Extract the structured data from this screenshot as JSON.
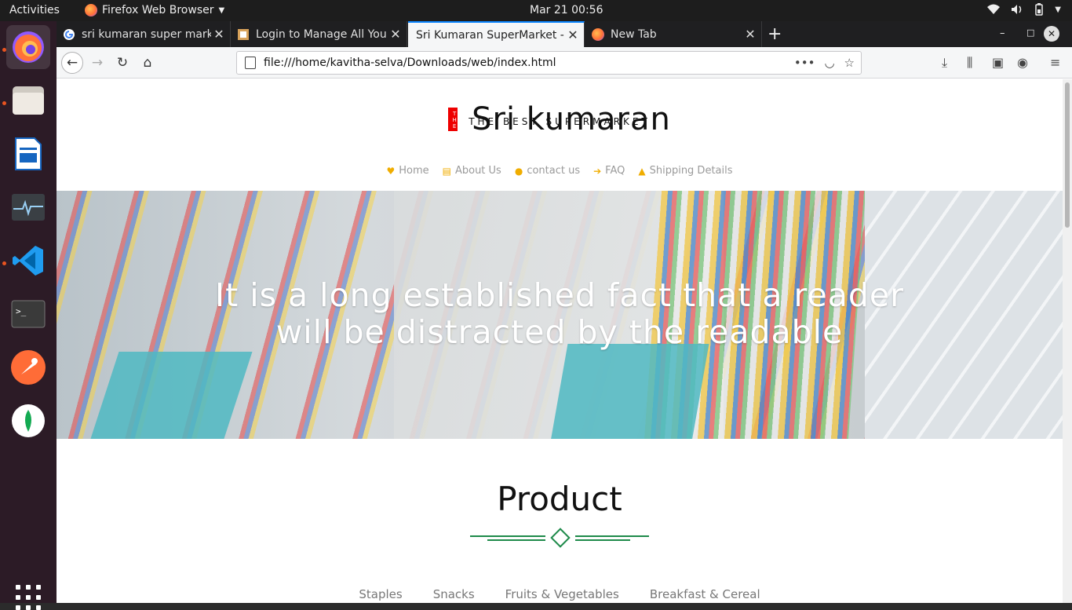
{
  "topbar": {
    "activities": "Activities",
    "app_name": "Firefox Web Browser",
    "clock": "Mar 21  00:56"
  },
  "browser": {
    "tabs": [
      {
        "title": "sri kumaran super market"
      },
      {
        "title": "Login to Manage All Your"
      },
      {
        "title": "Sri Kumaran SuperMarket - c"
      },
      {
        "title": "New Tab"
      }
    ],
    "url": "file:///home/kavitha-selva/Downloads/web/index.html"
  },
  "page": {
    "logo": {
      "badge": "THE",
      "name": "Sri kumaran",
      "tagline": "THE BEST SUPERMARKET"
    },
    "menu": [
      {
        "icon": "heart-icon",
        "label": "Home"
      },
      {
        "icon": "document-icon",
        "label": "About Us"
      },
      {
        "icon": "user-icon",
        "label": "contact us"
      },
      {
        "icon": "arrow-right-icon",
        "label": "FAQ"
      },
      {
        "icon": "truck-icon",
        "label": "Shipping Details"
      }
    ],
    "hero_text": "It is a long established fact that a reader will be distracted by the readable",
    "section_title": "Product",
    "categories": [
      "Staples",
      "Snacks",
      "Fruits & Vegetables",
      "Breakfast & Cereal"
    ]
  },
  "colors": {
    "accent_green": "#1e8a4a",
    "menu_icon": "#f0ad00",
    "ubuntu_orange": "#e95420",
    "tab_highlight": "#0a84ff"
  }
}
